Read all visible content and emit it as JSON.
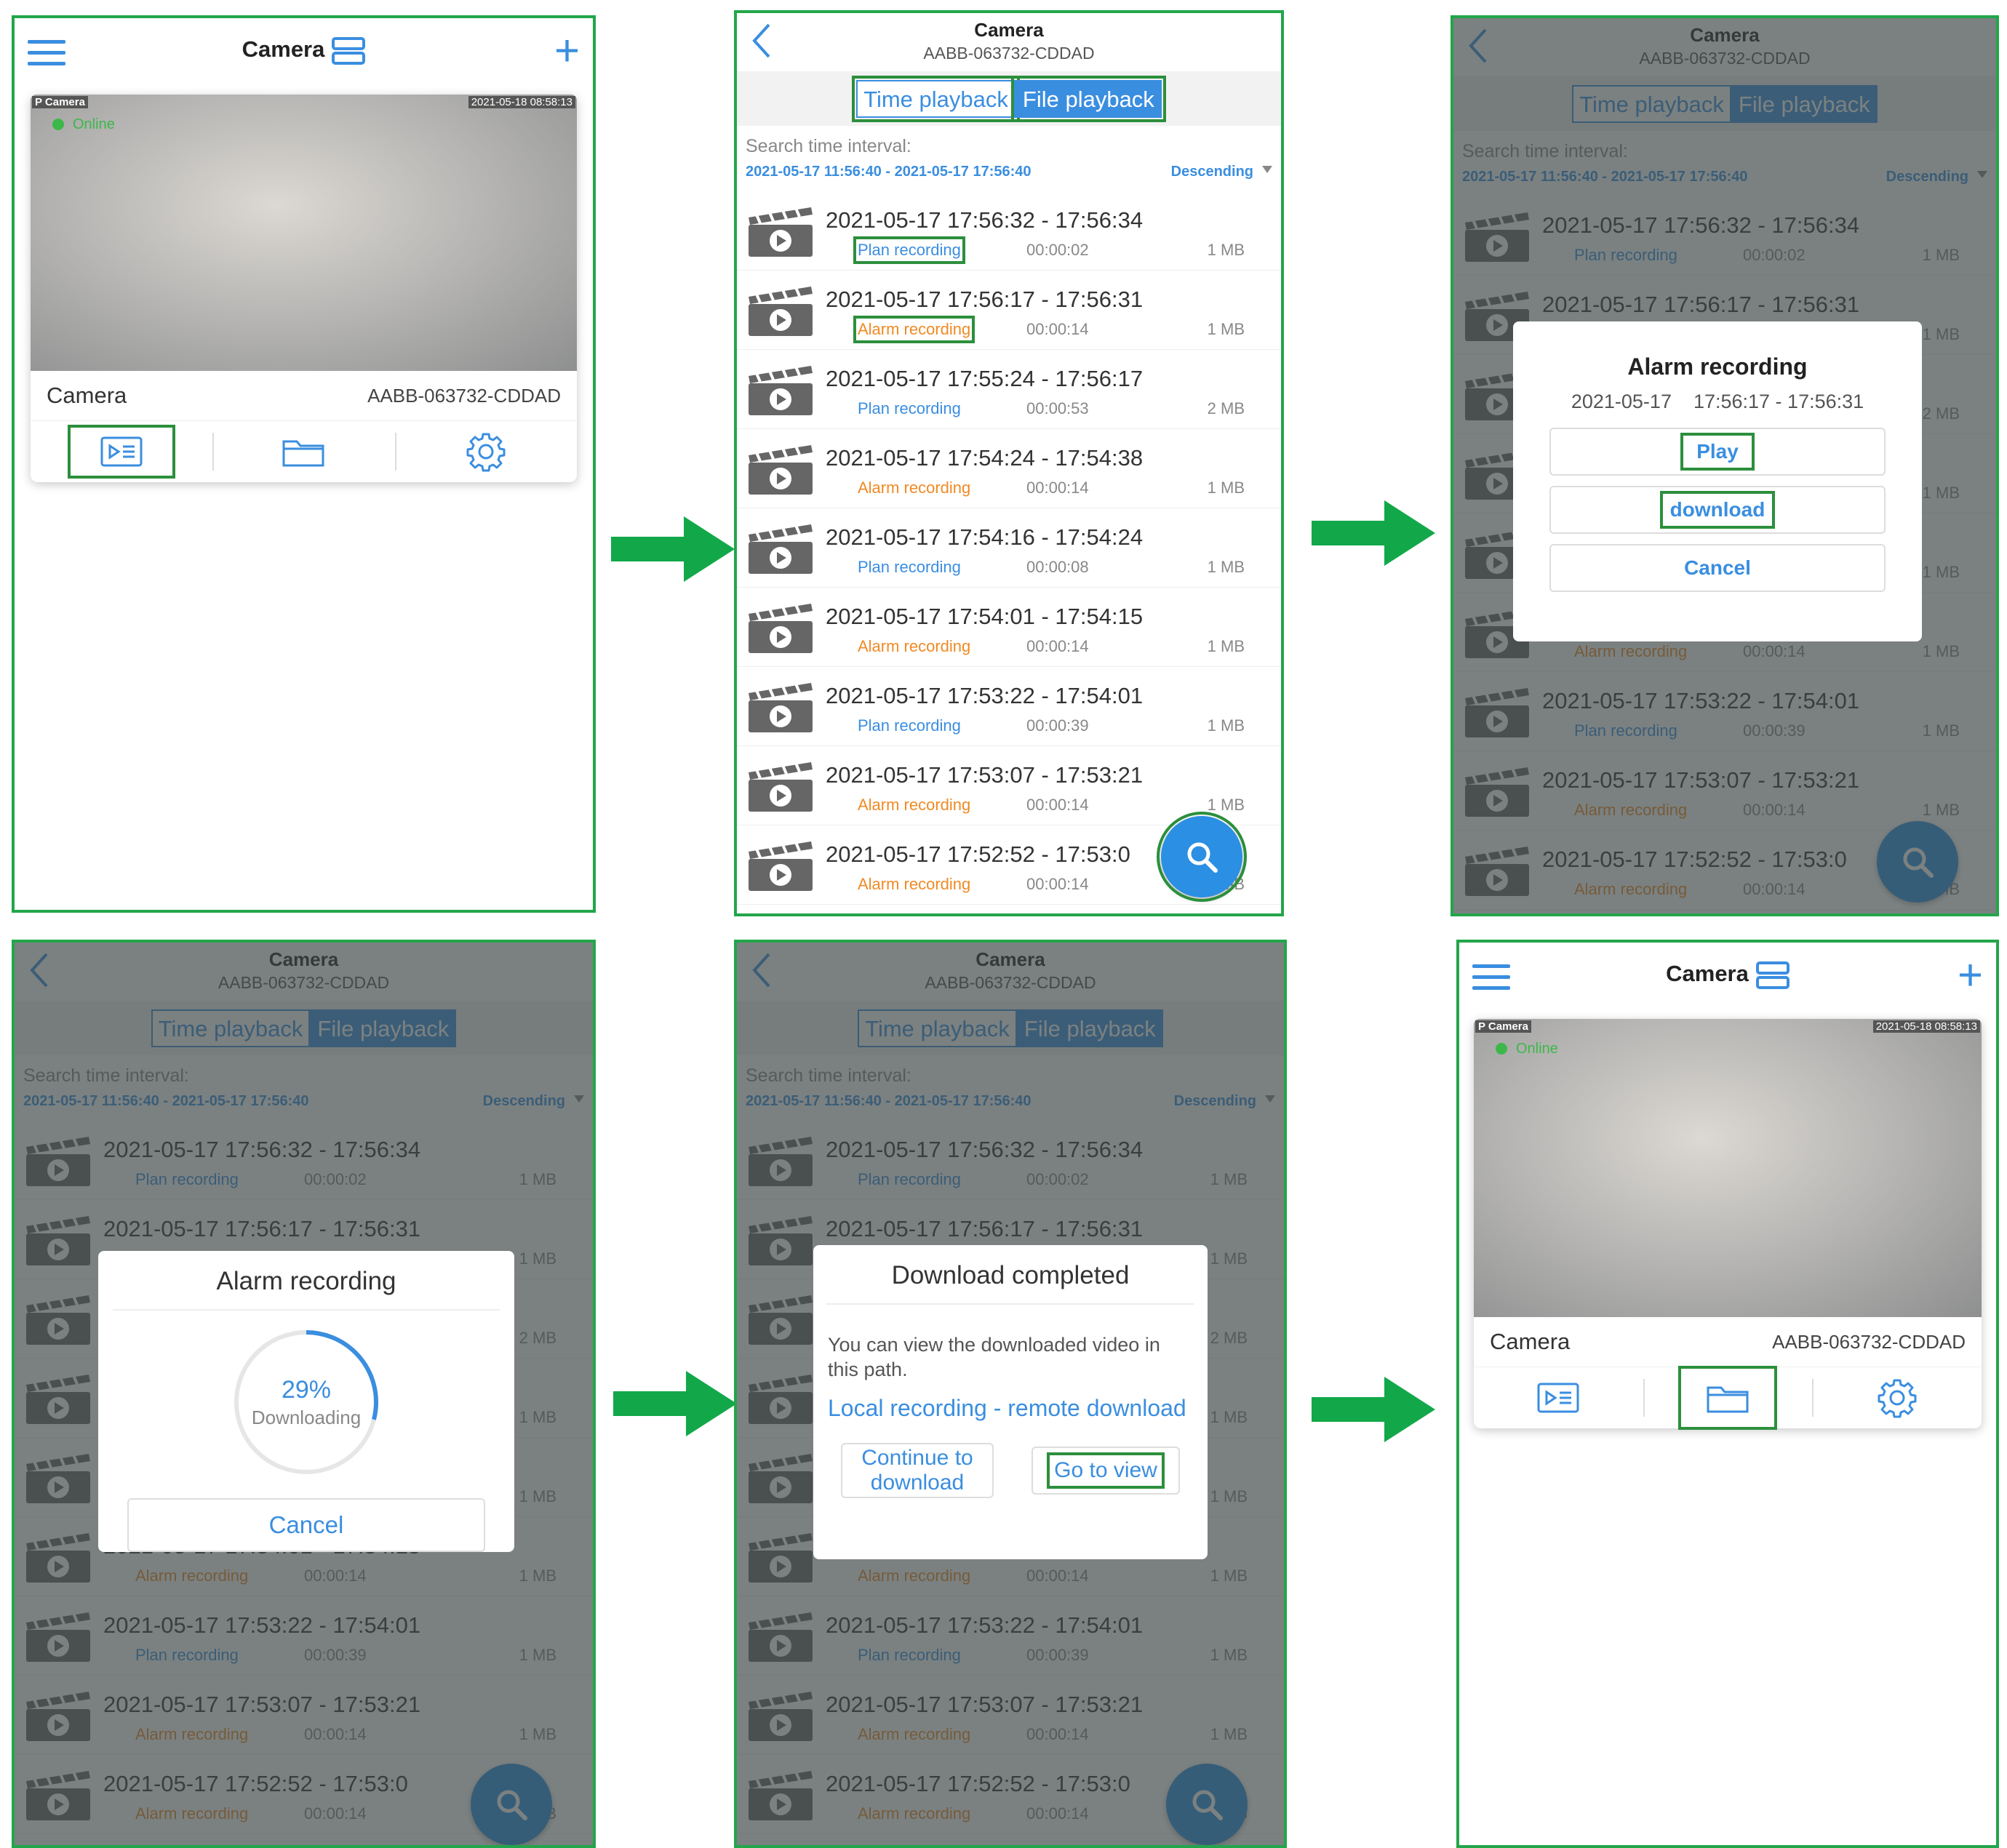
{
  "app": {
    "title": "Camera",
    "device_id": "AABB-063732-CDDAD"
  },
  "home": {
    "camera_name": "Camera",
    "camera_id": "AABB-063732-CDDAD",
    "overlay_left": "P Camera",
    "overlay_time": "2021-05-18 08:58:13",
    "status": "Online"
  },
  "playback": {
    "tab_time": "Time playback",
    "tab_file": "File playback",
    "search_label": "Search time interval:",
    "search_range": "2021-05-17 11:56:40 - 2021-05-17 17:56:40",
    "sort": "Descending",
    "records": [
      {
        "time": "2021-05-17  17:56:32 - 17:56:34",
        "type": "Plan recording",
        "kind": "plan",
        "duration": "00:00:02",
        "size": "1 MB"
      },
      {
        "time": "2021-05-17  17:56:17 - 17:56:31",
        "type": "Alarm recording",
        "kind": "alarm",
        "duration": "00:00:14",
        "size": "1 MB"
      },
      {
        "time": "2021-05-17  17:55:24 - 17:56:17",
        "type": "Plan recording",
        "kind": "plan",
        "duration": "00:00:53",
        "size": "2 MB"
      },
      {
        "time": "2021-05-17  17:54:24 - 17:54:38",
        "type": "Alarm recording",
        "kind": "alarm",
        "duration": "00:00:14",
        "size": "1 MB"
      },
      {
        "time": "2021-05-17  17:54:16 - 17:54:24",
        "type": "Plan recording",
        "kind": "plan",
        "duration": "00:00:08",
        "size": "1 MB"
      },
      {
        "time": "2021-05-17  17:54:01 - 17:54:15",
        "type": "Alarm recording",
        "kind": "alarm",
        "duration": "00:00:14",
        "size": "1 MB"
      },
      {
        "time": "2021-05-17  17:53:22 - 17:54:01",
        "type": "Plan recording",
        "kind": "plan",
        "duration": "00:00:39",
        "size": "1 MB"
      },
      {
        "time": "2021-05-17  17:53:07 - 17:53:21",
        "type": "Alarm recording",
        "kind": "alarm",
        "duration": "00:00:14",
        "size": "1 MB"
      },
      {
        "time": "2021-05-17  17:52:52 - 17:53:0",
        "type": "Alarm recording",
        "kind": "alarm",
        "duration": "00:00:14",
        "size": "1 MB"
      }
    ]
  },
  "dialog_action": {
    "title": "Alarm recording",
    "time": "2021-05-17    17:56:17 - 17:56:31",
    "play": "Play",
    "download": "download",
    "cancel": "Cancel"
  },
  "dialog_progress": {
    "title": "Alarm recording",
    "percent_text": "29%",
    "progress": 0.29,
    "status": "Downloading",
    "cancel": "Cancel"
  },
  "dialog_done": {
    "title": "Download completed",
    "message": "You can view the downloaded video in this path.",
    "path": "Local recording - remote download",
    "continue": "Continue to download",
    "go": "Go to view"
  },
  "colors": {
    "accent": "#3a8ee0",
    "highlight": "#2c8f3c",
    "arrow": "#12a84a",
    "alarm": "#f08a24"
  }
}
